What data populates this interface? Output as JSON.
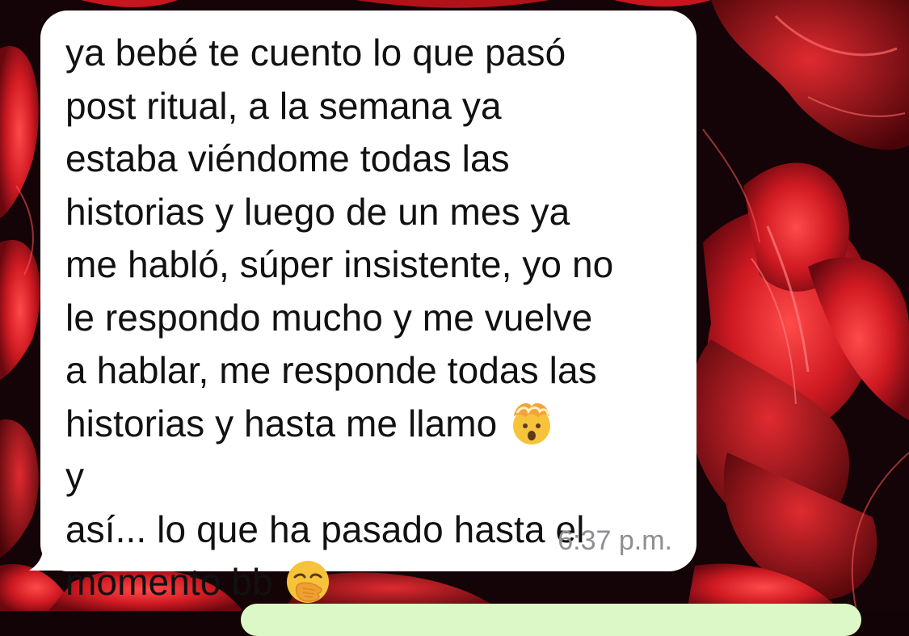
{
  "message": {
    "lines": [
      "ya bebé te cuento lo que pasó",
      "post ritual, a la semana ya",
      "estaba viéndome todas las",
      "historias y luego de un mes ya",
      "me habló, súper insistente, yo no",
      "le respondo mucho y me vuelve",
      "a hablar, me responde todas las",
      "historias y hasta me llamo",
      "y",
      "así... lo que ha pasado hasta el",
      "momento bb"
    ],
    "emoji_1": "exploding-head-emoji",
    "emoji_2": "face-with-hand-over-mouth-emoji",
    "time": "6:37 p.m."
  },
  "colors": {
    "bubble_incoming": "#ffffff",
    "bubble_outgoing": "#dcf8c6",
    "text": "#111111",
    "timestamp": "#8e8e93",
    "wallpaper_base": "#120306",
    "wallpaper_flower": "#c8161e"
  }
}
